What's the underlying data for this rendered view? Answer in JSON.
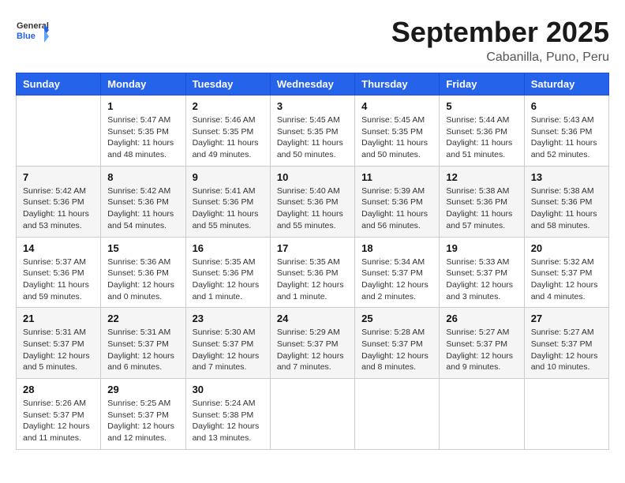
{
  "logo": {
    "general": "General",
    "blue": "Blue"
  },
  "title": "September 2025",
  "location": "Cabanilla, Puno, Peru",
  "days_of_week": [
    "Sunday",
    "Monday",
    "Tuesday",
    "Wednesday",
    "Thursday",
    "Friday",
    "Saturday"
  ],
  "weeks": [
    [
      {
        "day": "",
        "info": ""
      },
      {
        "day": "1",
        "info": "Sunrise: 5:47 AM\nSunset: 5:35 PM\nDaylight: 11 hours\nand 48 minutes."
      },
      {
        "day": "2",
        "info": "Sunrise: 5:46 AM\nSunset: 5:35 PM\nDaylight: 11 hours\nand 49 minutes."
      },
      {
        "day": "3",
        "info": "Sunrise: 5:45 AM\nSunset: 5:35 PM\nDaylight: 11 hours\nand 50 minutes."
      },
      {
        "day": "4",
        "info": "Sunrise: 5:45 AM\nSunset: 5:35 PM\nDaylight: 11 hours\nand 50 minutes."
      },
      {
        "day": "5",
        "info": "Sunrise: 5:44 AM\nSunset: 5:36 PM\nDaylight: 11 hours\nand 51 minutes."
      },
      {
        "day": "6",
        "info": "Sunrise: 5:43 AM\nSunset: 5:36 PM\nDaylight: 11 hours\nand 52 minutes."
      }
    ],
    [
      {
        "day": "7",
        "info": "Sunrise: 5:42 AM\nSunset: 5:36 PM\nDaylight: 11 hours\nand 53 minutes."
      },
      {
        "day": "8",
        "info": "Sunrise: 5:42 AM\nSunset: 5:36 PM\nDaylight: 11 hours\nand 54 minutes."
      },
      {
        "day": "9",
        "info": "Sunrise: 5:41 AM\nSunset: 5:36 PM\nDaylight: 11 hours\nand 55 minutes."
      },
      {
        "day": "10",
        "info": "Sunrise: 5:40 AM\nSunset: 5:36 PM\nDaylight: 11 hours\nand 55 minutes."
      },
      {
        "day": "11",
        "info": "Sunrise: 5:39 AM\nSunset: 5:36 PM\nDaylight: 11 hours\nand 56 minutes."
      },
      {
        "day": "12",
        "info": "Sunrise: 5:38 AM\nSunset: 5:36 PM\nDaylight: 11 hours\nand 57 minutes."
      },
      {
        "day": "13",
        "info": "Sunrise: 5:38 AM\nSunset: 5:36 PM\nDaylight: 11 hours\nand 58 minutes."
      }
    ],
    [
      {
        "day": "14",
        "info": "Sunrise: 5:37 AM\nSunset: 5:36 PM\nDaylight: 11 hours\nand 59 minutes."
      },
      {
        "day": "15",
        "info": "Sunrise: 5:36 AM\nSunset: 5:36 PM\nDaylight: 12 hours\nand 0 minutes."
      },
      {
        "day": "16",
        "info": "Sunrise: 5:35 AM\nSunset: 5:36 PM\nDaylight: 12 hours\nand 1 minute."
      },
      {
        "day": "17",
        "info": "Sunrise: 5:35 AM\nSunset: 5:36 PM\nDaylight: 12 hours\nand 1 minute."
      },
      {
        "day": "18",
        "info": "Sunrise: 5:34 AM\nSunset: 5:37 PM\nDaylight: 12 hours\nand 2 minutes."
      },
      {
        "day": "19",
        "info": "Sunrise: 5:33 AM\nSunset: 5:37 PM\nDaylight: 12 hours\nand 3 minutes."
      },
      {
        "day": "20",
        "info": "Sunrise: 5:32 AM\nSunset: 5:37 PM\nDaylight: 12 hours\nand 4 minutes."
      }
    ],
    [
      {
        "day": "21",
        "info": "Sunrise: 5:31 AM\nSunset: 5:37 PM\nDaylight: 12 hours\nand 5 minutes."
      },
      {
        "day": "22",
        "info": "Sunrise: 5:31 AM\nSunset: 5:37 PM\nDaylight: 12 hours\nand 6 minutes."
      },
      {
        "day": "23",
        "info": "Sunrise: 5:30 AM\nSunset: 5:37 PM\nDaylight: 12 hours\nand 7 minutes."
      },
      {
        "day": "24",
        "info": "Sunrise: 5:29 AM\nSunset: 5:37 PM\nDaylight: 12 hours\nand 7 minutes."
      },
      {
        "day": "25",
        "info": "Sunrise: 5:28 AM\nSunset: 5:37 PM\nDaylight: 12 hours\nand 8 minutes."
      },
      {
        "day": "26",
        "info": "Sunrise: 5:27 AM\nSunset: 5:37 PM\nDaylight: 12 hours\nand 9 minutes."
      },
      {
        "day": "27",
        "info": "Sunrise: 5:27 AM\nSunset: 5:37 PM\nDaylight: 12 hours\nand 10 minutes."
      }
    ],
    [
      {
        "day": "28",
        "info": "Sunrise: 5:26 AM\nSunset: 5:37 PM\nDaylight: 12 hours\nand 11 minutes."
      },
      {
        "day": "29",
        "info": "Sunrise: 5:25 AM\nSunset: 5:37 PM\nDaylight: 12 hours\nand 12 minutes."
      },
      {
        "day": "30",
        "info": "Sunrise: 5:24 AM\nSunset: 5:38 PM\nDaylight: 12 hours\nand 13 minutes."
      },
      {
        "day": "",
        "info": ""
      },
      {
        "day": "",
        "info": ""
      },
      {
        "day": "",
        "info": ""
      },
      {
        "day": "",
        "info": ""
      }
    ]
  ]
}
